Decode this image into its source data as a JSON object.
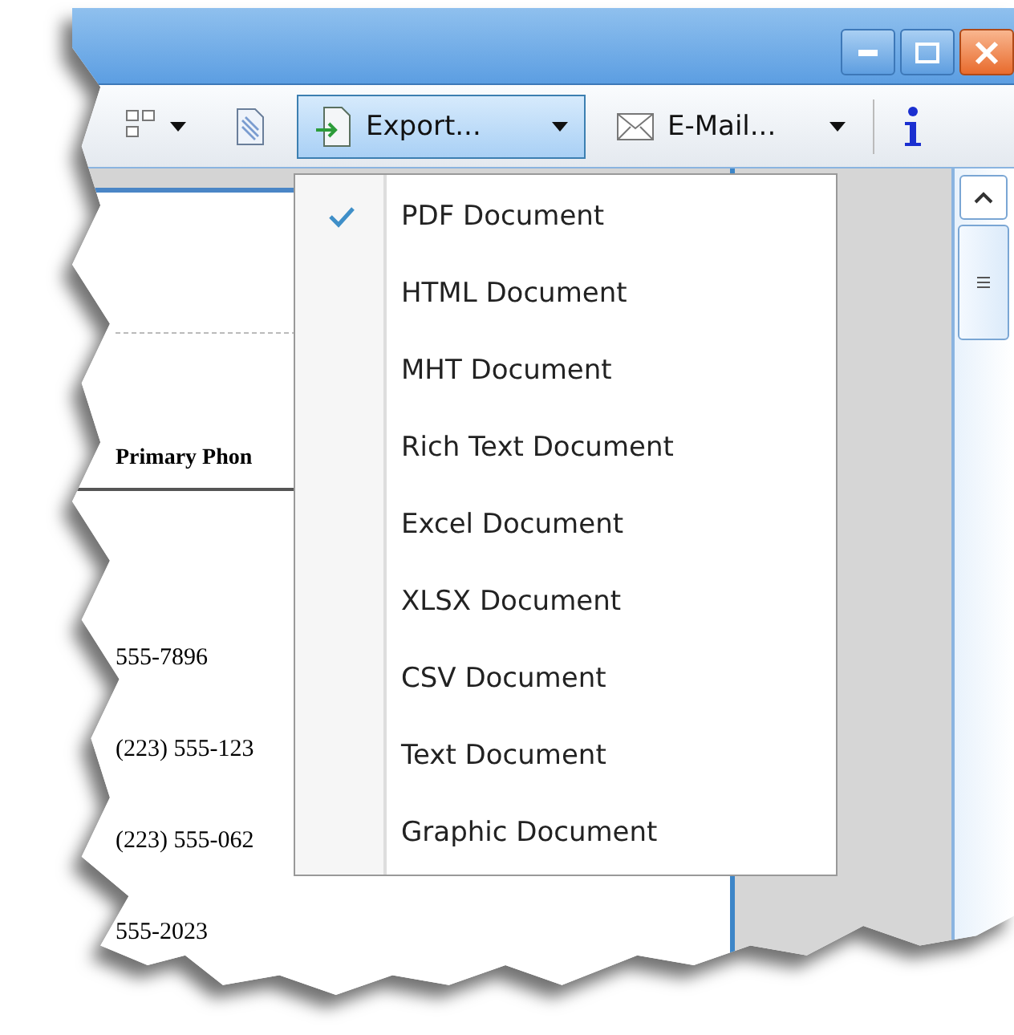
{
  "toolbar": {
    "buttons": [
      {
        "kind": "layout",
        "dropdown": true,
        "selected": false
      },
      {
        "kind": "page",
        "dropdown": false,
        "selected": false
      },
      {
        "kind": "export",
        "label": "Export...",
        "dropdown": true,
        "selected": true
      },
      {
        "kind": "email",
        "label": "E-Mail...",
        "dropdown": true,
        "selected": false
      },
      {
        "kind": "info",
        "dropdown": false,
        "selected": false
      }
    ]
  },
  "document": {
    "column_header": "Primary Phon",
    "rows": [
      "555-7896",
      "(223) 555-123",
      "(223) 555-062",
      "555-2023"
    ]
  },
  "export_menu": {
    "items": [
      {
        "label": "PDF Document",
        "checked": true
      },
      {
        "label": "HTML Document",
        "checked": false
      },
      {
        "label": "MHT Document",
        "checked": false
      },
      {
        "label": "Rich Text Document",
        "checked": false
      },
      {
        "label": "Excel Document",
        "checked": false
      },
      {
        "label": "XLSX Document",
        "checked": false
      },
      {
        "label": "CSV Document",
        "checked": false
      },
      {
        "label": "Text Document",
        "checked": false
      },
      {
        "label": "Graphic Document",
        "checked": false
      }
    ]
  }
}
